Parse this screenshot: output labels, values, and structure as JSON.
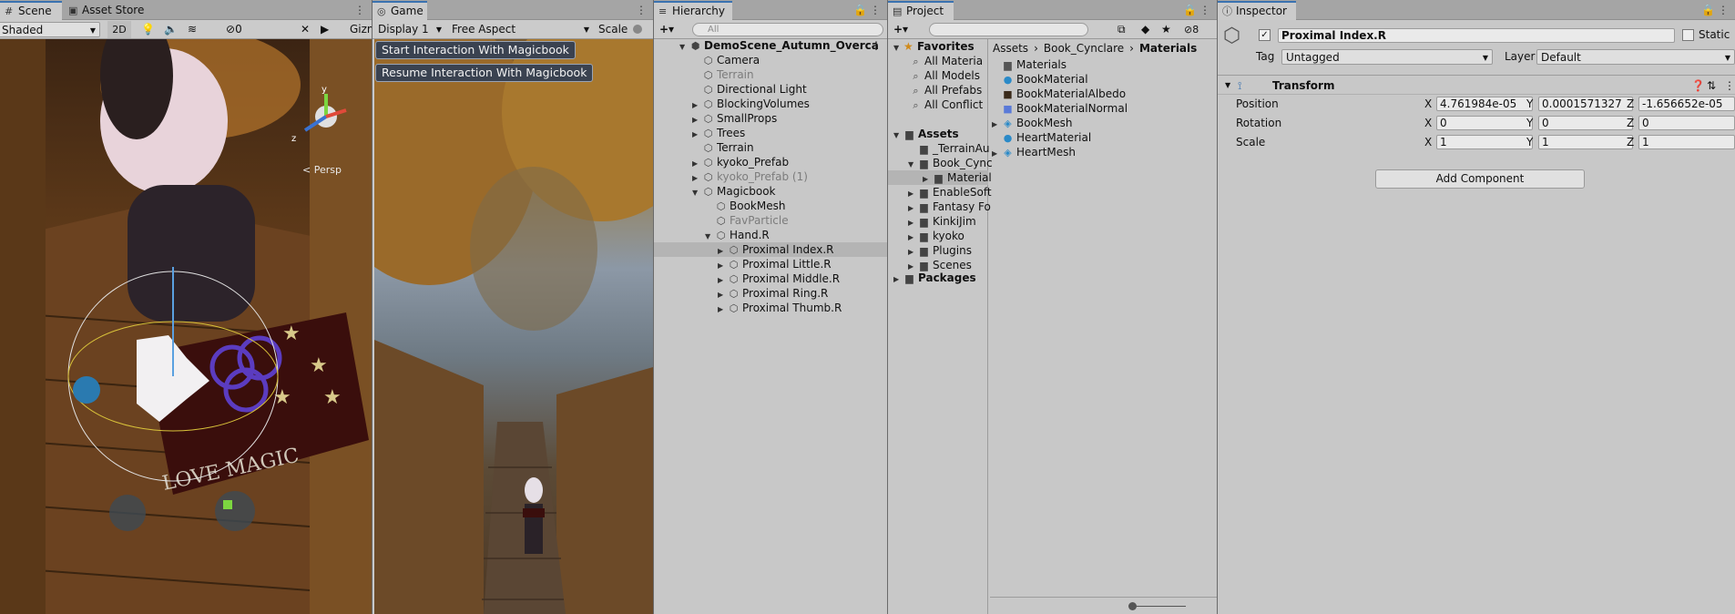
{
  "scene": {
    "tabs": [
      "Scene",
      "Asset Store"
    ],
    "shading_mode": "Shaded",
    "mode_2d": "2D",
    "hidden_count": "0",
    "gizmos_label": "Gizm",
    "persp_label": "< Persp",
    "axis_y": "y",
    "axis_z": "z",
    "book_text": "LOVE MAGIC"
  },
  "game": {
    "tab": "Game",
    "display": "Display 1",
    "aspect": "Free Aspect",
    "scale_label": "Scale",
    "buttons": [
      "Start Interaction With Magicbook",
      "Resume Interaction With Magicbook"
    ]
  },
  "hierarchy": {
    "tab": "Hierarchy",
    "search_placeholder": "All",
    "items": [
      {
        "label": "DemoScene_Autumn_Overca",
        "depth": 0,
        "fold": "open",
        "dim": false,
        "icon": "scene-icon"
      },
      {
        "label": "Camera",
        "depth": 1,
        "fold": "none",
        "dim": false,
        "icon": "gameobject-icon"
      },
      {
        "label": "Terrain",
        "depth": 1,
        "fold": "none",
        "dim": true,
        "icon": "gameobject-icon"
      },
      {
        "label": "Directional Light",
        "depth": 1,
        "fold": "none",
        "dim": false,
        "icon": "gameobject-icon"
      },
      {
        "label": "BlockingVolumes",
        "depth": 1,
        "fold": "closed",
        "dim": false,
        "icon": "gameobject-icon"
      },
      {
        "label": "SmallProps",
        "depth": 1,
        "fold": "closed",
        "dim": false,
        "icon": "gameobject-icon"
      },
      {
        "label": "Trees",
        "depth": 1,
        "fold": "closed",
        "dim": false,
        "icon": "gameobject-icon"
      },
      {
        "label": "Terrain",
        "depth": 1,
        "fold": "none",
        "dim": false,
        "icon": "gameobject-icon"
      },
      {
        "label": "kyoko_Prefab",
        "depth": 1,
        "fold": "closed",
        "dim": false,
        "icon": "gameobject-icon"
      },
      {
        "label": "kyoko_Prefab (1)",
        "depth": 1,
        "fold": "closed",
        "dim": true,
        "icon": "gameobject-icon"
      },
      {
        "label": "Magicbook",
        "depth": 1,
        "fold": "open",
        "dim": false,
        "icon": "gameobject-icon"
      },
      {
        "label": "BookMesh",
        "depth": 2,
        "fold": "none",
        "dim": false,
        "icon": "gameobject-icon"
      },
      {
        "label": "FavParticle",
        "depth": 2,
        "fold": "none",
        "dim": true,
        "icon": "gameobject-icon"
      },
      {
        "label": "Hand.R",
        "depth": 2,
        "fold": "open",
        "dim": false,
        "icon": "gameobject-icon"
      },
      {
        "label": "Proximal Index.R",
        "depth": 3,
        "fold": "closed",
        "dim": false,
        "icon": "gameobject-icon",
        "selected": true
      },
      {
        "label": "Proximal Little.R",
        "depth": 3,
        "fold": "closed",
        "dim": false,
        "icon": "gameobject-icon"
      },
      {
        "label": "Proximal Middle.R",
        "depth": 3,
        "fold": "closed",
        "dim": false,
        "icon": "gameobject-icon"
      },
      {
        "label": "Proximal Ring.R",
        "depth": 3,
        "fold": "closed",
        "dim": false,
        "icon": "gameobject-icon"
      },
      {
        "label": "Proximal Thumb.R",
        "depth": 3,
        "fold": "closed",
        "dim": false,
        "icon": "gameobject-icon"
      }
    ]
  },
  "project": {
    "tab": "Project",
    "hidden_count": "8",
    "favorites_label": "Favorites",
    "favorites": [
      "All Materia",
      "All Models",
      "All Prefabs",
      "All Conflict"
    ],
    "assets_label": "Assets",
    "tree": [
      {
        "label": "_TerrainAu",
        "depth": 1,
        "fold": "none"
      },
      {
        "label": "Book_Cync",
        "depth": 1,
        "fold": "open"
      },
      {
        "label": "Material",
        "depth": 2,
        "fold": "closed",
        "selected": true
      },
      {
        "label": "EnableSoft",
        "depth": 1,
        "fold": "closed"
      },
      {
        "label": "Fantasy Fo",
        "depth": 1,
        "fold": "closed"
      },
      {
        "label": "KinkiJim",
        "depth": 1,
        "fold": "closed"
      },
      {
        "label": "kyoko",
        "depth": 1,
        "fold": "closed"
      },
      {
        "label": "Plugins",
        "depth": 1,
        "fold": "closed"
      },
      {
        "label": "Scenes",
        "depth": 1,
        "fold": "closed"
      }
    ],
    "packages_label": "Packages",
    "breadcrumb": [
      "Assets",
      "Book_Cynclare",
      "Materials"
    ],
    "files": [
      {
        "label": "Materials",
        "icon": "folder-icon",
        "fold": "none"
      },
      {
        "label": "BookMaterial",
        "icon": "material-icon",
        "fold": "none"
      },
      {
        "label": "BookMaterialAlbedo",
        "icon": "texture-icon",
        "fold": "none"
      },
      {
        "label": "BookMaterialNormal",
        "icon": "normalmap-icon",
        "fold": "none"
      },
      {
        "label": "BookMesh",
        "icon": "prefab-icon",
        "fold": "closed"
      },
      {
        "label": "HeartMaterial",
        "icon": "material-icon",
        "fold": "none"
      },
      {
        "label": "HeartMesh",
        "icon": "prefab-icon",
        "fold": "closed"
      }
    ]
  },
  "inspector": {
    "tab": "Inspector",
    "object_name": "Proximal Index.R",
    "static_label": "Static",
    "tag_label": "Tag",
    "tag_value": "Untagged",
    "layer_label": "Layer",
    "layer_value": "Default",
    "component_title": "Transform",
    "position_label": "Position",
    "rotation_label": "Rotation",
    "scale_label": "Scale",
    "position": {
      "x": "4.761984e-05",
      "y": "0.0001571327",
      "z": "-1.656652e-05"
    },
    "rotation": {
      "x": "0",
      "y": "0",
      "z": "0"
    },
    "scale": {
      "x": "1",
      "y": "1",
      "z": "1"
    },
    "axes": [
      "X",
      "Y",
      "Z"
    ],
    "add_component": "Add Component"
  },
  "colors": {
    "accent": "#3a72b0",
    "panel": "#c8c8c8",
    "tabbar": "#a5a5a5",
    "selection": "#b4b4b4"
  }
}
